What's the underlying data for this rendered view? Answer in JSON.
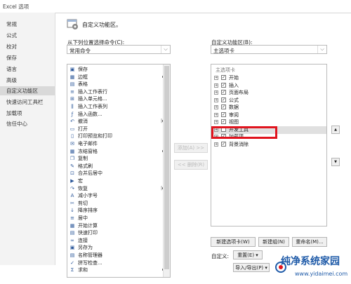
{
  "window": {
    "title": "Excel 选项"
  },
  "nav": {
    "items": [
      {
        "label": "常规"
      },
      {
        "label": "公式"
      },
      {
        "label": "校对"
      },
      {
        "label": "保存"
      },
      {
        "label": "语言"
      },
      {
        "label": "高级"
      },
      {
        "label": "自定义功能区",
        "active": true
      },
      {
        "label": "快速访问工具栏"
      },
      {
        "label": "加载项"
      },
      {
        "label": "信任中心"
      }
    ]
  },
  "header": {
    "text": "自定义功能区。"
  },
  "left": {
    "choose_label": "从下列位置选择命令(C):",
    "choose_value": "常用命令",
    "commands": [
      {
        "icon": "save-icon",
        "glyph": "▣",
        "label": "保存"
      },
      {
        "icon": "border-icon",
        "glyph": "▦",
        "label": "边框",
        "sub": "▸"
      },
      {
        "icon": "table-icon",
        "glyph": "▤",
        "label": "表格"
      },
      {
        "icon": "insert-row-icon",
        "glyph": "≡",
        "label": "插入工作表行"
      },
      {
        "icon": "insert-cell-icon",
        "glyph": "⊞",
        "label": "插入单元格..."
      },
      {
        "icon": "insert-col-icon",
        "glyph": "⫼",
        "label": "插入工作表列"
      },
      {
        "icon": "function-icon",
        "glyph": "ƒ",
        "label": "插入函数..."
      },
      {
        "icon": "undo-icon",
        "glyph": "↶",
        "label": "撤消",
        "sub": "|▸"
      },
      {
        "icon": "open-icon",
        "glyph": "▭",
        "label": "打开"
      },
      {
        "icon": "print-preview-icon",
        "glyph": "▯",
        "label": "打印预览和打印"
      },
      {
        "icon": "email-icon",
        "glyph": "✉",
        "label": "电子邮件"
      },
      {
        "icon": "freeze-icon",
        "glyph": "▦",
        "label": "冻结窗格",
        "sub": "▸"
      },
      {
        "icon": "copy-icon",
        "glyph": "❐",
        "label": "复制"
      },
      {
        "icon": "format-painter-icon",
        "glyph": "✎",
        "label": "格式刷"
      },
      {
        "icon": "merge-icon",
        "glyph": "⊡",
        "label": "合并后居中"
      },
      {
        "icon": "macro-icon",
        "glyph": "▶",
        "label": "宏"
      },
      {
        "icon": "redo-icon",
        "glyph": "↷",
        "label": "恢复",
        "sub": "|▸"
      },
      {
        "icon": "font-size-down-icon",
        "glyph": "A",
        "label": "减小字号"
      },
      {
        "icon": "cut-icon",
        "glyph": "✂",
        "label": "剪切"
      },
      {
        "icon": "sort-desc-icon",
        "glyph": "↓",
        "label": "降序排序"
      },
      {
        "icon": "center-icon",
        "glyph": "≡",
        "label": "居中"
      },
      {
        "icon": "calc-icon",
        "glyph": "▦",
        "label": "开始计算"
      },
      {
        "icon": "quick-print-icon",
        "glyph": "▤",
        "label": "快速打印"
      },
      {
        "icon": "link-icon",
        "glyph": "∞",
        "label": "连接"
      },
      {
        "icon": "save-as-icon",
        "glyph": "▣",
        "label": "另存为"
      },
      {
        "icon": "name-manager-icon",
        "glyph": "▤",
        "label": "名称管理器"
      },
      {
        "icon": "spelling-icon",
        "glyph": "✓",
        "label": "拼写检查..."
      },
      {
        "icon": "sum-icon",
        "glyph": "Σ",
        "label": "求和",
        "sub": "▸"
      }
    ]
  },
  "middle": {
    "add_label": "添加(A) >>",
    "remove_label": "<< 删除(R)"
  },
  "right": {
    "customize_label": "自定义功能区(B):",
    "customize_value": "主选项卡",
    "tree_root": "主选项卡",
    "tabs": [
      {
        "label": "开始",
        "checked": true
      },
      {
        "label": "插入",
        "checked": true
      },
      {
        "label": "页面布局",
        "checked": true
      },
      {
        "label": "公式",
        "checked": true
      },
      {
        "label": "数据",
        "checked": true
      },
      {
        "label": "审阅",
        "checked": true
      },
      {
        "label": "视图",
        "checked": true
      },
      {
        "label": "开发工具",
        "checked": false,
        "selected": true
      },
      {
        "label": "加载项",
        "checked": true
      },
      {
        "label": "背景消除",
        "checked": true
      }
    ],
    "new_tab_label": "新建选项卡(W)",
    "new_group_label": "新建组(N)",
    "rename_label": "重命名(M)...",
    "customizations_label": "自定义:",
    "reset_label": "重置(E) ▾",
    "import_export_label": "导入/导出(P) ▾",
    "move_up": "▲",
    "move_down": "▼"
  },
  "watermark": {
    "title": "纯净系统家园",
    "url": "www.yidaimei.com"
  },
  "colors": {
    "highlight": "#e0141e",
    "nav_active": "#d9d9d9",
    "watermark": "#1e5aa8"
  }
}
